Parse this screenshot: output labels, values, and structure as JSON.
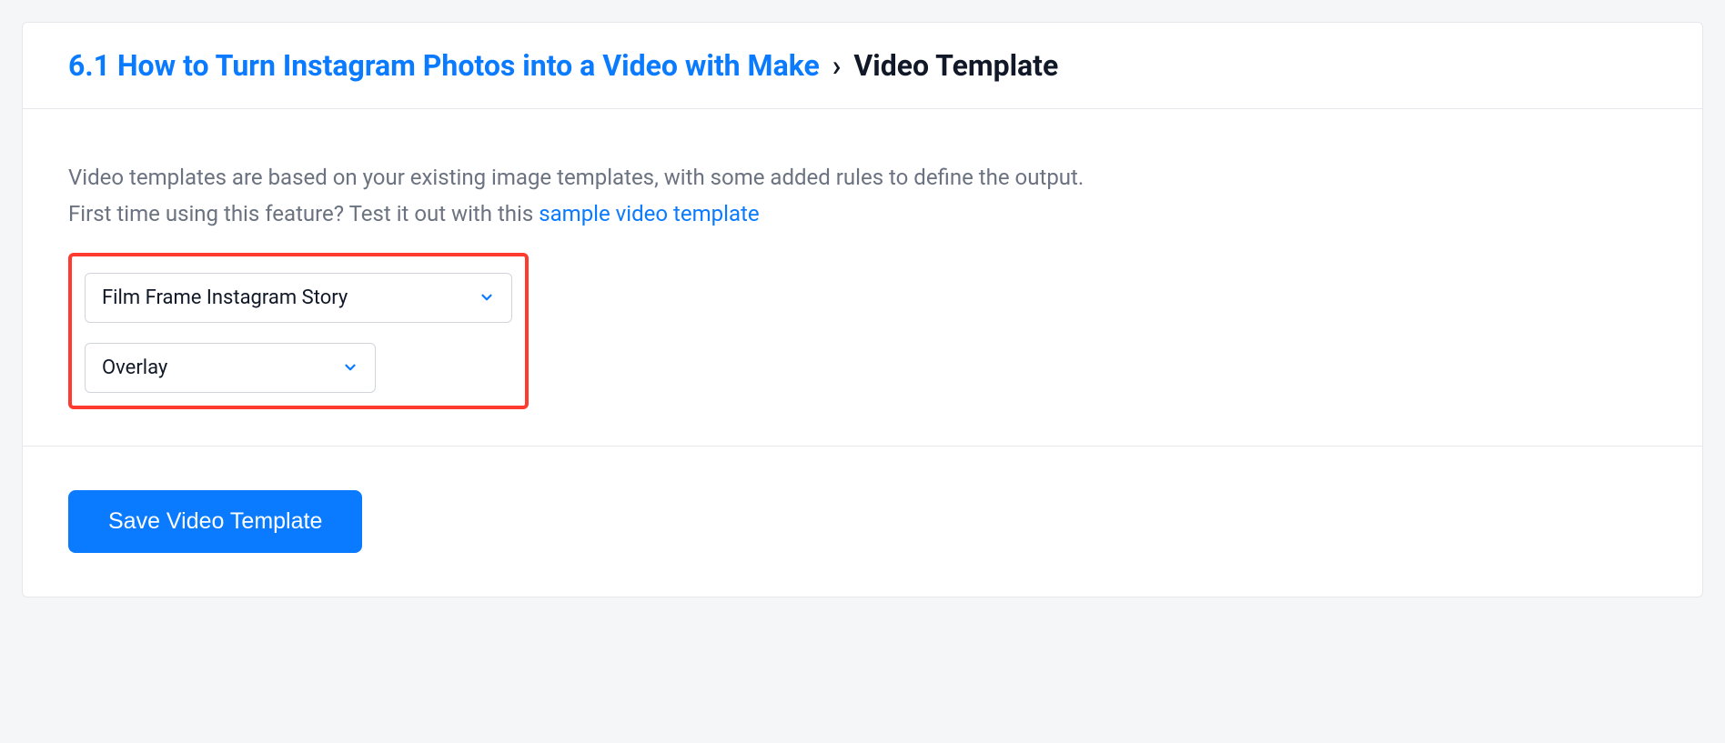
{
  "header": {
    "breadcrumb_link": "6.1 How to Turn Instagram Photos into a Video with Make",
    "breadcrumb_sep": "›",
    "breadcrumb_current": "Video Template"
  },
  "body": {
    "description_line1": "Video templates are based on your existing image templates, with some added rules to define the output.",
    "description_line2_prefix": "First time using this feature? Test it out with this ",
    "sample_link_text": "sample video template",
    "template_select": "Film Frame Instagram Story",
    "type_select": "Overlay"
  },
  "footer": {
    "save_button": "Save Video Template"
  }
}
